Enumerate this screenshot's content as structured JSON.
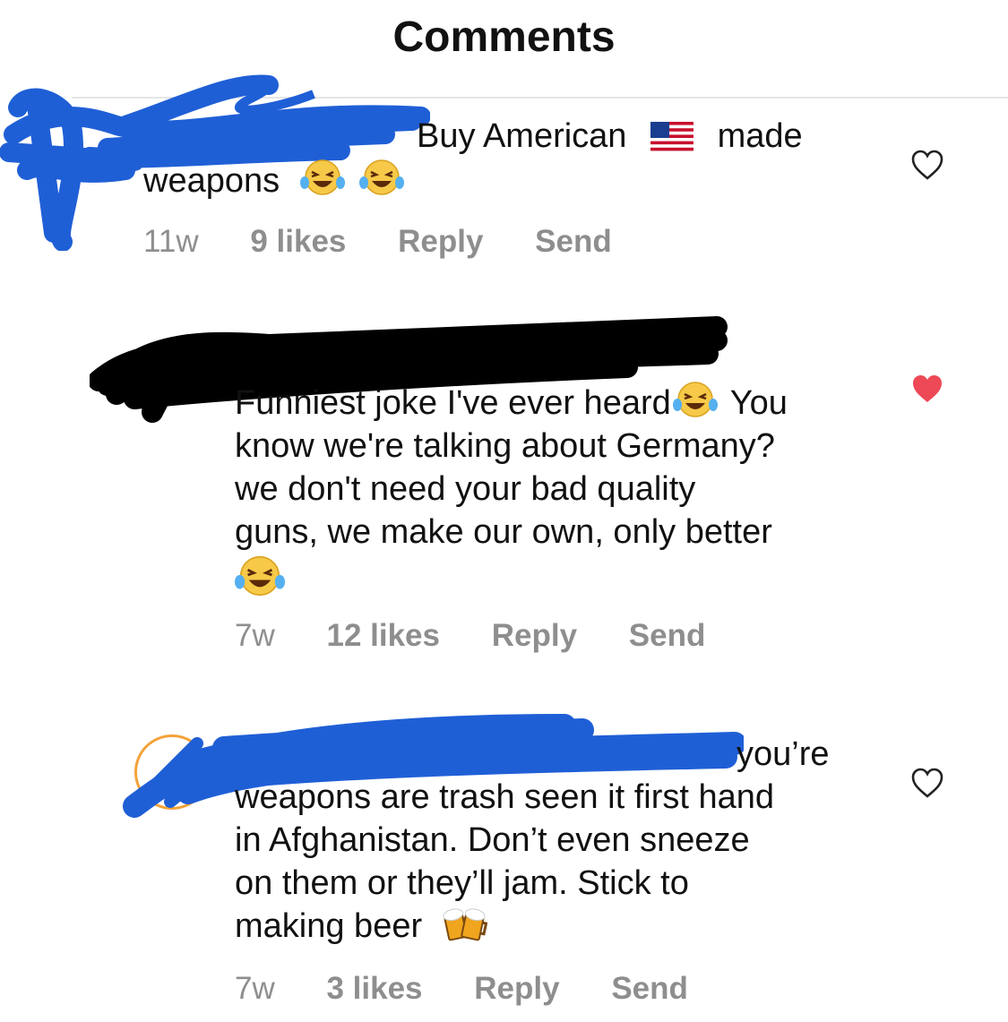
{
  "header": {
    "title": "Comments"
  },
  "comments": [
    {
      "text_head": "Buy American",
      "flag_icon": "us-flag-icon",
      "text_mid": "made",
      "text_line2": "weapons",
      "emoji": [
        "laughing-tears-icon",
        "laughing-tears-icon"
      ],
      "age": "11w",
      "likes": "9 likes",
      "reply": "Reply",
      "send": "Send",
      "liked": false
    },
    {
      "line1a": "Funniest joke I've ever heard",
      "line1b": "You",
      "line2": "know we're talking about Germany?",
      "line3": "we don't need your bad quality",
      "line4": "guns, we make our own, only better",
      "emoji": [
        "laughing-tears-icon",
        "laughing-tears-icon"
      ],
      "age": "7w",
      "likes": "12 likes",
      "reply": "Reply",
      "send": "Send",
      "liked": true
    },
    {
      "line1": "you’re",
      "line2": "weapons are trash seen it first hand",
      "line3": "in Afghanistan. Don’t even sneeze",
      "line4": "on them or they’ll jam. Stick to",
      "line5": "making beer",
      "emoji": [
        "beer-mugs-icon"
      ],
      "age": "7w",
      "likes": "3 likes",
      "reply": "Reply",
      "send": "Send",
      "liked": false
    }
  ],
  "colors": {
    "liked_heart": "#ed4956",
    "meta_gray": "#8e8e8e",
    "redaction_blue": "#1f5fd6",
    "redaction_black": "#000000"
  }
}
